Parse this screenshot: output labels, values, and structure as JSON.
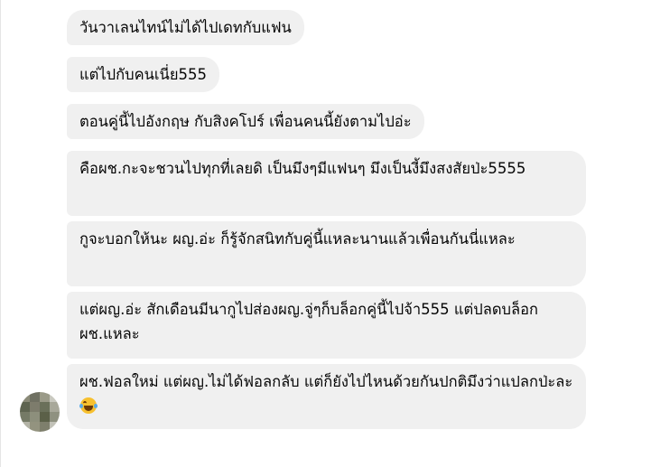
{
  "messages": [
    {
      "text": "วันวาเลนไทน์ไม่ได้ไปเดทกับแฟน"
    },
    {
      "text": "แต่ไปกับคนเนี่ย555"
    },
    {
      "text": "ตอนคู่นี้ไปอังกฤษ กับสิงคโปร์ เพื่อนคนนี้ยังตามไปอ่ะ"
    },
    {
      "text": "คือผช.กะจะชวนไปทุกที่เลยดิ เป็นมึงๆมีแฟนๆ มึงเป็นงี้มึงสงสัยป่ะ5555"
    },
    {
      "text": "กูจะบอกให้นะ ผญ.อ่ะ ก็รู้จักสนิทกับคู่นี้แหละนานแล้วเพื่อนกันนี่แหละ"
    },
    {
      "text": "แต่ผญ.อ่ะ สักเดือนมีนากูไปส่องผญ.จู่ๆก็บล็อกคู่นี้ไปจ้า555 แต่ปลดบล็อกผช.แหละ"
    },
    {
      "text": "ผช.ฟอลใหม่ แต่ผญ.ไม่ได้ฟอลกลับ แต่ก็ยังไปไหนด้วยกันปกติมึงว่าแปลกป่ะละ",
      "emoji": "laughing-tears-emoji"
    }
  ],
  "colors": {
    "bubble_bg": "#f0f0f0",
    "text": "#050505",
    "page_bg": "#ffffff"
  },
  "sender": {
    "avatar_icon": "pixelated-avatar"
  }
}
